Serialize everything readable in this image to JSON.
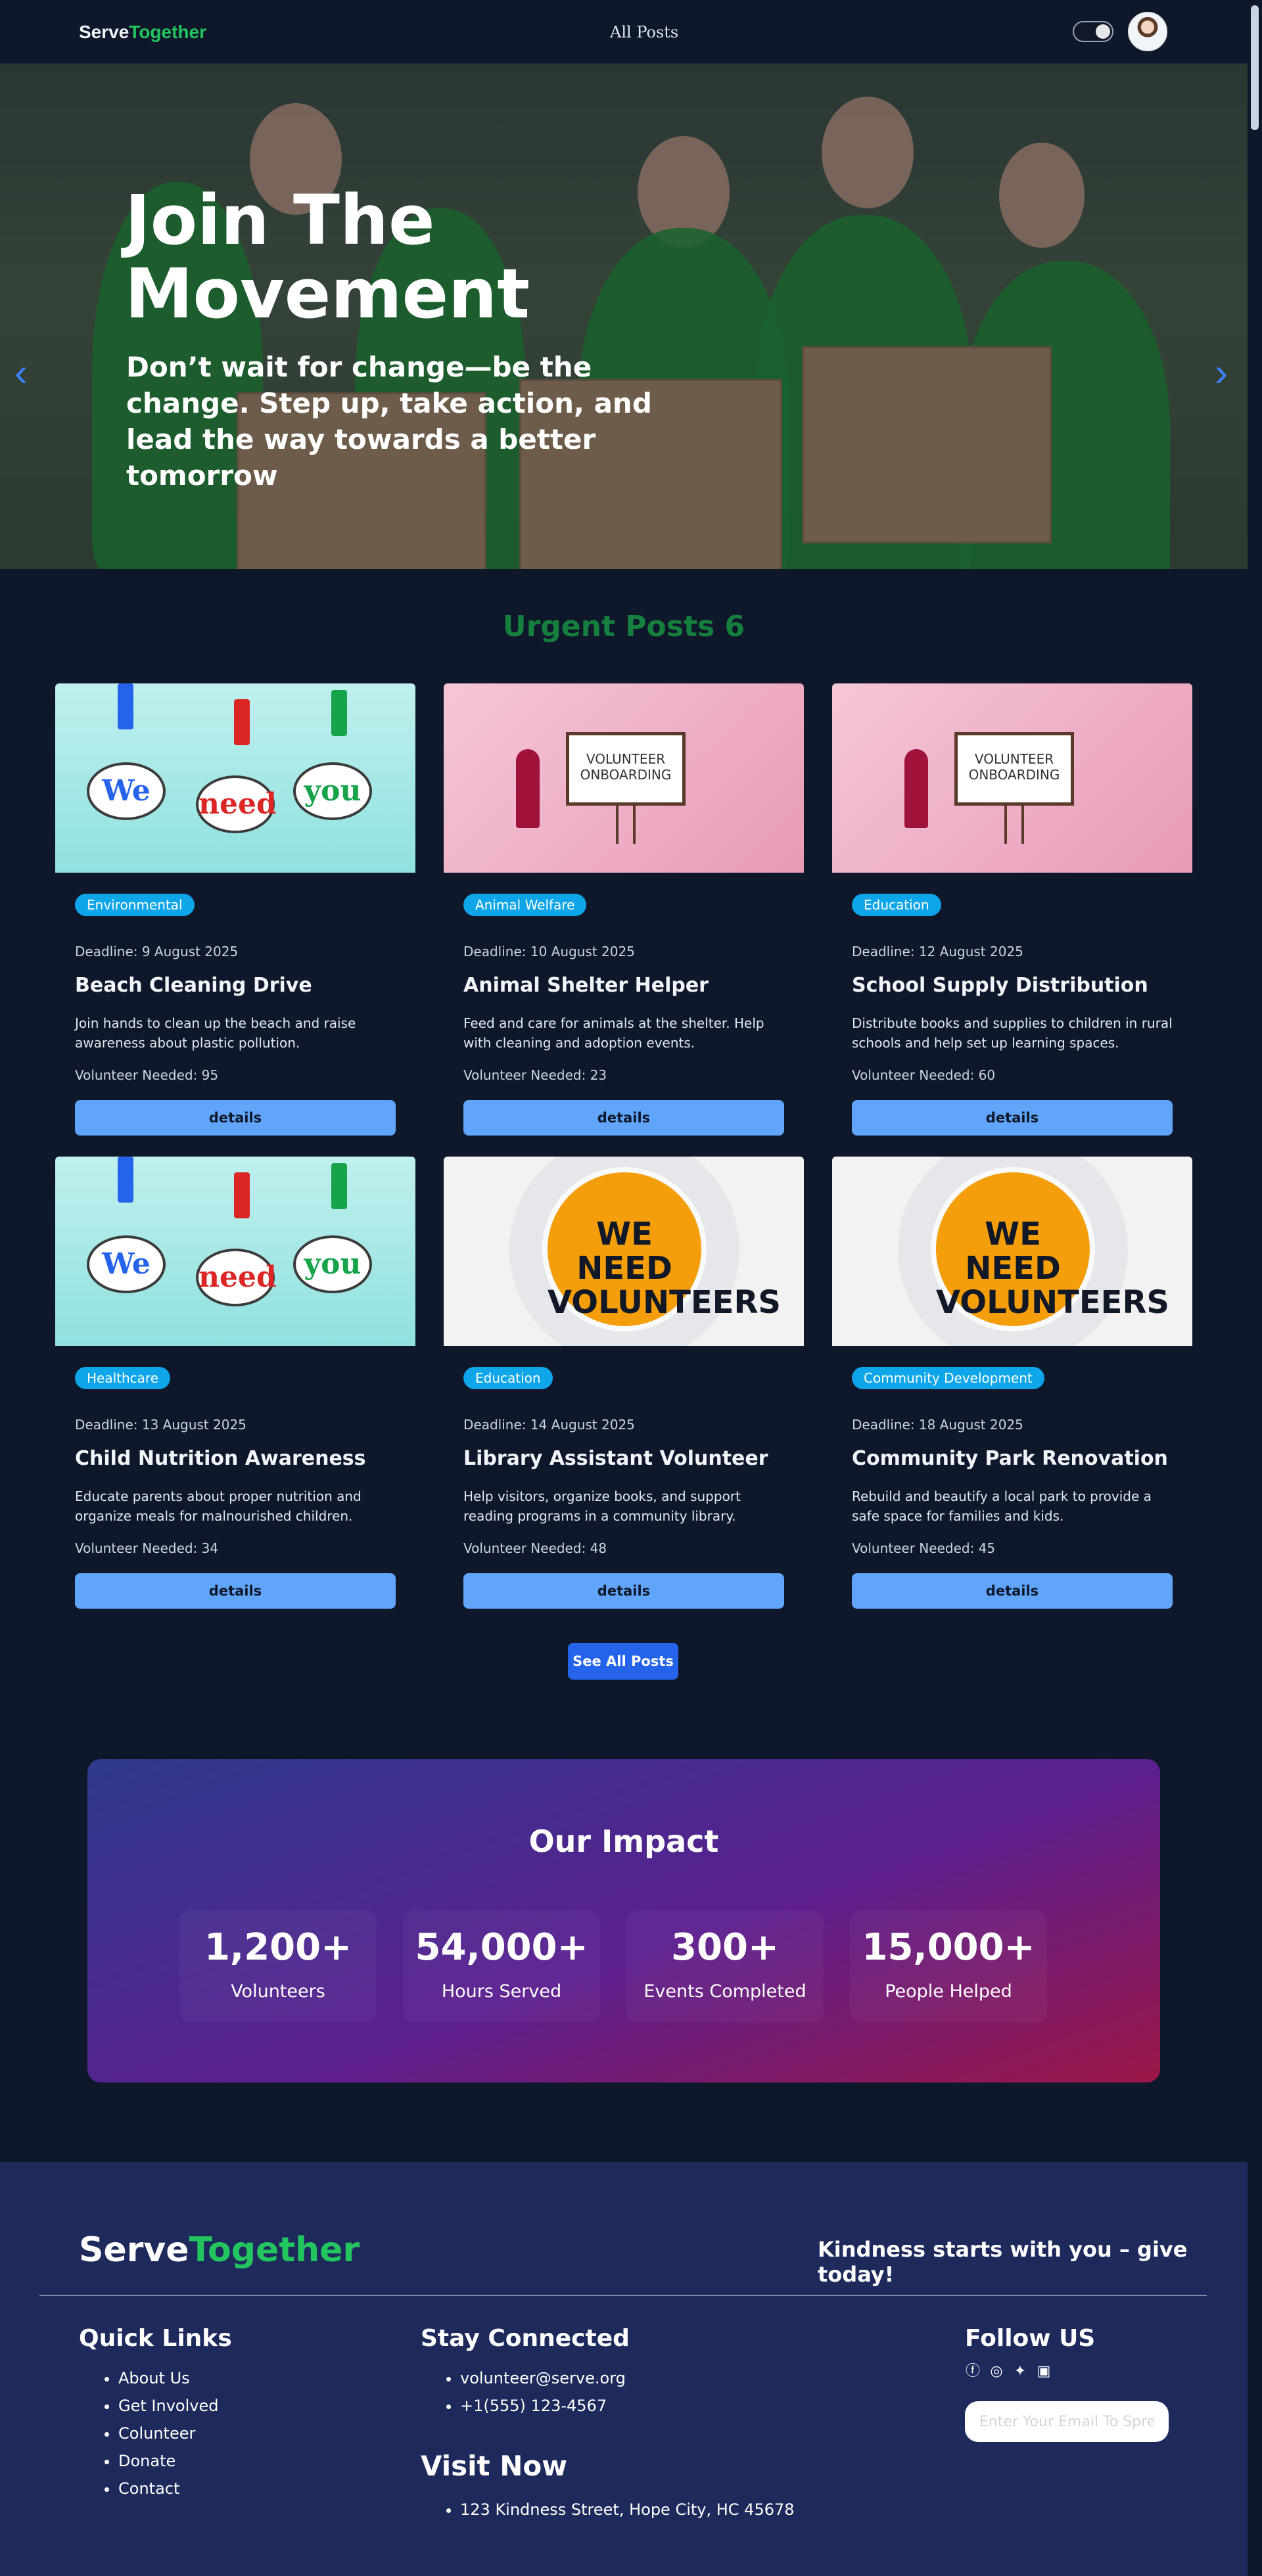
{
  "navbar": {
    "brand_part1": "Serve",
    "brand_part2": "Together",
    "link": "All Posts",
    "theme_toggle_icon": "moon-icon",
    "avatar_icon": "user-avatar"
  },
  "hero": {
    "title": "Join The Movement",
    "subtitle": "Don’t wait for change—be the change. Step up, take action, and lead the way towards a better tomorrow",
    "prev_icon": "chevron-left-icon",
    "next_icon": "chevron-right-icon"
  },
  "urgent": {
    "title": "Urgent Posts 6",
    "posts": [
      {
        "category": "Environmental",
        "deadline": "Deadline: 9 August 2025",
        "title": "Beach Cleaning Drive",
        "description": "Join hands to clean up the beach and raise awareness about plastic pollution.",
        "needed": "Volunteer Needed: 95",
        "button": "details",
        "image": "we-need-you"
      },
      {
        "category": "Animal Welfare",
        "deadline": "Deadline: 10 August 2025",
        "title": "Animal Shelter Helper",
        "description": "Feed and care for animals at the shelter. Help with cleaning and adoption events.",
        "needed": "Volunteer Needed: 23",
        "button": "details",
        "image": "volunteer-onboarding"
      },
      {
        "category": "Education",
        "deadline": "Deadline: 12 August 2025",
        "title": "School Supply Distribution",
        "description": "Distribute books and supplies to children in rural schools and help set up learning spaces.",
        "needed": "Volunteer Needed: 60",
        "button": "details",
        "image": "volunteer-onboarding"
      },
      {
        "category": "Healthcare",
        "deadline": "Deadline: 13 August 2025",
        "title": "Child Nutrition Awareness",
        "description": "Educate parents about proper nutrition and organize meals for malnourished children.",
        "needed": "Volunteer Needed: 34",
        "button": "details",
        "image": "we-need-you"
      },
      {
        "category": "Education",
        "deadline": "Deadline: 14 August 2025",
        "title": "Library Assistant Volunteer",
        "description": "Help visitors, organize books, and support reading programs in a community library.",
        "needed": "Volunteer Needed: 48",
        "button": "details",
        "image": "we-need-volunteers"
      },
      {
        "category": "Community Development",
        "deadline": "Deadline: 18 August 2025",
        "title": "Community Park Renovation",
        "description": "Rebuild and beautify a local park to provide a safe space for families and kids.",
        "needed": "Volunteer Needed: 45",
        "button": "details",
        "image": "we-need-volunteers"
      }
    ],
    "see_all": "See All Posts"
  },
  "impact": {
    "title": "Our Impact",
    "stats": [
      {
        "value": "1,200+",
        "label": "Volunteers"
      },
      {
        "value": "54,000+",
        "label": "Hours Served"
      },
      {
        "value": "300+",
        "label": "Events Completed"
      },
      {
        "value": "15,000+",
        "label": "People Helped"
      }
    ]
  },
  "footer": {
    "brand_part1": "Serve",
    "brand_part2": "Together",
    "tagline": "Kindness starts with you – give today!",
    "quick_links_title": "Quick Links",
    "quick_links": [
      "About Us",
      "Get Involved",
      "Colunteer",
      "Donate",
      "Contact"
    ],
    "stay_connected_title": "Stay Connected",
    "contacts": [
      "volunteer@serve.org",
      "+1(555) 123-4567"
    ],
    "visit_title": "Visit Now",
    "address": "123 Kindness Street, Hope City, HC 45678",
    "follow_title": "Follow US",
    "social_icons": [
      "facebook-icon",
      "instagram-icon",
      "twitter-icon",
      "linkedin-icon"
    ],
    "email_placeholder": "Enter Your Email To Spre"
  },
  "colors": {
    "background": "#0f172a",
    "brand_accent": "#22c55e",
    "urgent_title": "#15803d",
    "badge": "#0ea5e9",
    "details_button": "#60a5fa",
    "see_all_button": "#2563eb",
    "footer_bg": "#1e2a5c"
  }
}
